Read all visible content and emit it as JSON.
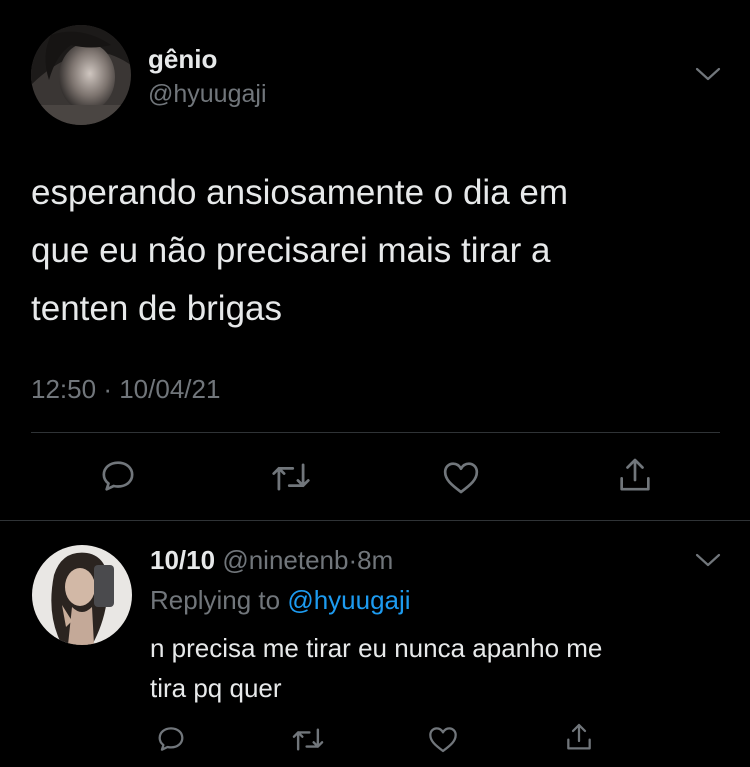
{
  "main_tweet": {
    "display_name": "gênio",
    "handle": "@hyuugaji",
    "text_lines": [
      "esperando ansiosamente o dia em",
      "que eu não precisarei mais tirar a",
      "tenten de brigas"
    ],
    "time": "12:50",
    "separator": "·",
    "date": "10/04/21",
    "actions": [
      "reply-icon",
      "retweet-icon",
      "like-icon",
      "share-icon"
    ]
  },
  "reply": {
    "display_name": "10/10",
    "handle": "@ninetenb",
    "separator": "·",
    "age": "8m",
    "replying_prefix": "Replying to",
    "replying_to": "@hyuugaji",
    "text_lines": [
      "n precisa me tirar eu nunca apanho me",
      "tira pq quer"
    ],
    "actions": [
      "reply-icon",
      "retweet-icon",
      "like-icon",
      "share-icon"
    ]
  },
  "colors": {
    "background": "#000000",
    "text": "#e7e9ea",
    "muted": "#71767b",
    "link": "#1d9bf0",
    "divider": "#2f3336"
  }
}
